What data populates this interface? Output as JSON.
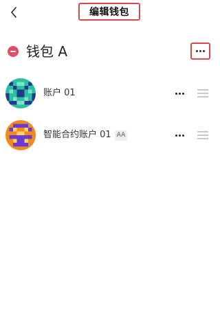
{
  "header": {
    "back_icon": "chevron-left-icon",
    "title": "编辑钱包"
  },
  "wallet": {
    "remove_icon": "minus-circle-icon",
    "name": "钱包 A",
    "more_icon": "more-horizontal-icon"
  },
  "accounts": [
    {
      "label": "账户 01",
      "avatar_colors": [
        "#2bbfa4",
        "#263a8a"
      ],
      "more_icon": "more-horizontal-icon",
      "drag_icon": "drag-handle-icon"
    },
    {
      "label": "智能合约账户 01",
      "badge": "AA",
      "avatar_colors": [
        "#f08a1c",
        "#6a3bd2"
      ],
      "more_icon": "more-horizontal-icon",
      "drag_icon": "drag-handle-icon"
    }
  ],
  "colors": {
    "highlight_border": "#e0474c",
    "remove_button": "#e34d62"
  }
}
